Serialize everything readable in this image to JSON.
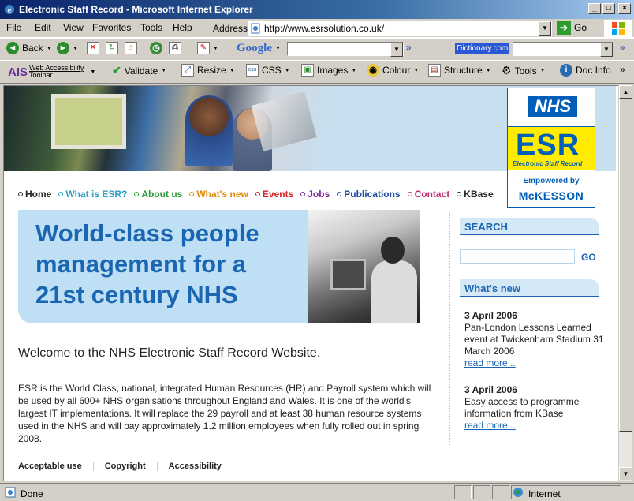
{
  "window": {
    "title": "Electronic Staff Record - Microsoft Internet Explorer",
    "buttons": {
      "minimize": "_",
      "maximize": "□",
      "close": "×"
    }
  },
  "menubar": {
    "items": [
      "File",
      "Edit",
      "View",
      "Favorites",
      "Tools",
      "Help"
    ],
    "address_label": "Address",
    "url": "http://www.esrsolution.co.uk/",
    "go_label": "Go"
  },
  "toolbar": {
    "back_label": "Back",
    "google_label": "Google",
    "search_value": "",
    "dictionary_label": "Dictionary.com",
    "chevron": "»"
  },
  "ais_toolbar": {
    "logo_text": "AIS",
    "name_line1": "Web Accessibility",
    "name_line2": "Toolbar",
    "items": [
      "Validate",
      "Resize",
      "CSS",
      "Images",
      "Colour",
      "Structure",
      "Tools",
      "Doc Info"
    ]
  },
  "logo": {
    "nhs": "NHS",
    "esr": "ESR",
    "esr_sub": "Electronic Staff Record",
    "powered_by": "Empowered by",
    "mckesson": "McKESSON"
  },
  "nav": {
    "items": [
      {
        "label": "Home",
        "color": "#222222"
      },
      {
        "label": "What is ESR?",
        "color": "#2a9fbf"
      },
      {
        "label": "About us",
        "color": "#2a9a3a"
      },
      {
        "label": "What's new",
        "color": "#e08a00"
      },
      {
        "label": "Events",
        "color": "#d42020"
      },
      {
        "label": "Jobs",
        "color": "#7a2a9a"
      },
      {
        "label": "Publications",
        "color": "#1a4aa0"
      },
      {
        "label": "Contact",
        "color": "#c02a70"
      },
      {
        "label": "KBase",
        "color": "#222222"
      }
    ]
  },
  "banner": {
    "headline": "World-class people\nmanagement for a\n21st century NHS"
  },
  "main": {
    "welcome": "Welcome to the NHS Electronic Staff Record Website.",
    "body": "ESR is the World Class, national, integrated Human Resources (HR) and Payroll system which will be used by all 600+ NHS organisations throughout England and Wales. It is one of the world's largest IT implementations. It will replace the 29 payroll and at least 38 human resource systems used in the NHS and will pay approximately 1.2 million employees when fully rolled out in spring 2008."
  },
  "footer": {
    "links": [
      "Acceptable use",
      "Copyright",
      "Accessibility"
    ]
  },
  "sidebar": {
    "search_heading": "SEARCH",
    "search_value": "",
    "go_label": "GO",
    "news_heading": "What's new",
    "news": [
      {
        "date": "3 April 2006",
        "text": "Pan-London Lessons Learned event at Twickenham Stadium 31 March 2006",
        "more": "read more..."
      },
      {
        "date": "3 April 2006",
        "text": "Easy access to programme information from KBase",
        "more": "read more..."
      }
    ]
  },
  "statusbar": {
    "status": "Done",
    "zone": "Internet"
  }
}
